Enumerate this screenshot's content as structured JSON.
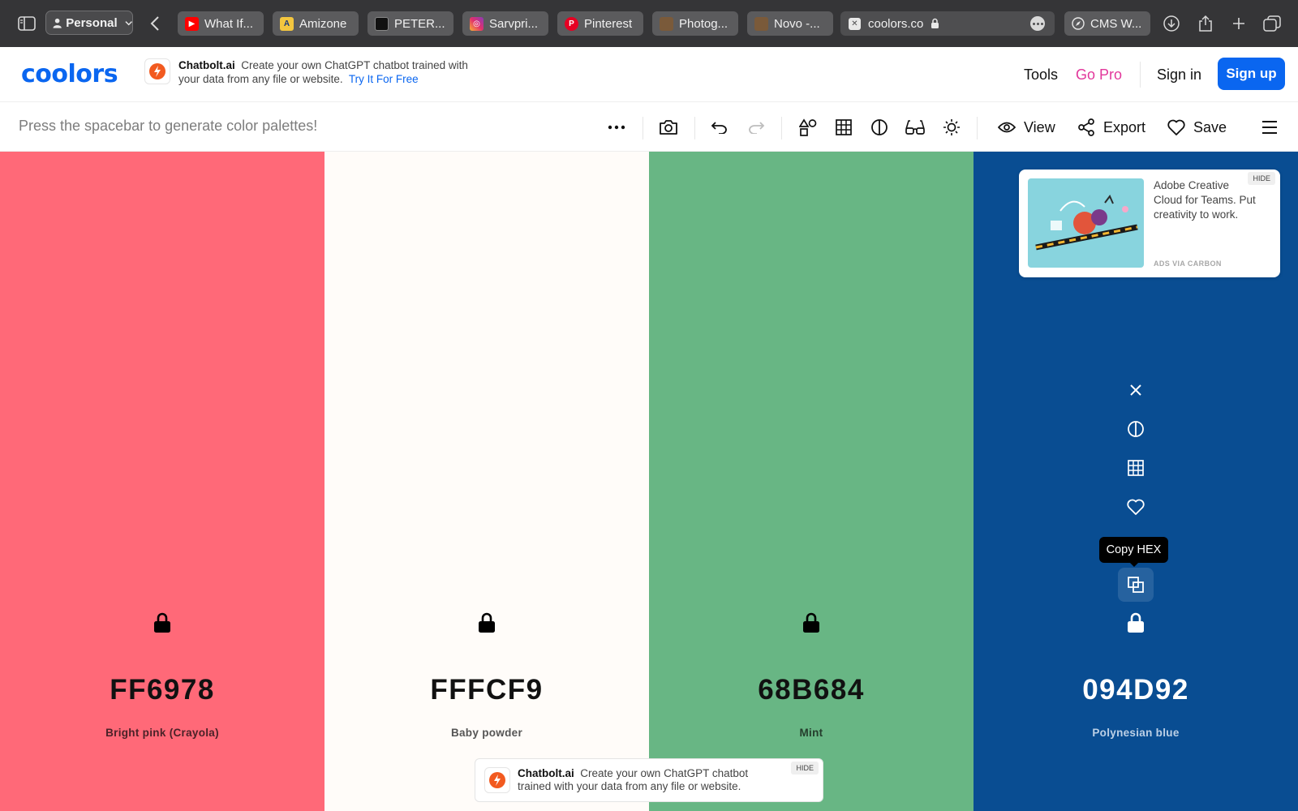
{
  "browser": {
    "profile": "Personal",
    "tabs": [
      {
        "title": "What If...",
        "favicon": "youtube-icon"
      },
      {
        "title": "Amizone",
        "favicon": "amizone-icon"
      },
      {
        "title": "PETER...",
        "favicon": "peter-icon"
      },
      {
        "title": "Sarvpri...",
        "favicon": "instagram-icon"
      },
      {
        "title": "Pinterest",
        "favicon": "pinterest-icon"
      },
      {
        "title": "Photog...",
        "favicon": "photo-icon"
      },
      {
        "title": "Novo -...",
        "favicon": "photo-icon"
      }
    ],
    "address": "coolors.co",
    "pinned_tab": "CMS W..."
  },
  "header": {
    "logo": "coolors",
    "promo": {
      "brand": "Chatbolt.ai",
      "text": "Create your own ChatGPT chatbot trained with your data from any file or website.",
      "cta": "Try It For Free"
    },
    "nav": {
      "tools": "Tools",
      "gopro": "Go Pro",
      "signin": "Sign in",
      "signup": "Sign up"
    },
    "colors": {
      "brand": "#0a66f0",
      "gopro": "#e2379b"
    }
  },
  "toolbar": {
    "hint": "Press the spacebar to generate color palettes!",
    "view": "View",
    "export": "Export",
    "save": "Save"
  },
  "palette": [
    {
      "hex": "FF6978",
      "name": "Bright pink (Crayola)",
      "color": "#FF6978",
      "text_color": "#111111",
      "name_color": "#4a2228"
    },
    {
      "hex": "FFFCF9",
      "name": "Baby powder",
      "color": "#FFFCF9",
      "text_color": "#111111",
      "name_color": "#555555"
    },
    {
      "hex": "68B684",
      "name": "Mint",
      "color": "#68B684",
      "text_color": "#111111",
      "name_color": "#253d2c"
    },
    {
      "hex": "094D92",
      "name": "Polynesian blue",
      "color": "#094D92",
      "text_color": "#ffffff",
      "name_color": "#bcd0e6"
    }
  ],
  "swatch_tools": {
    "tooltip": "Copy HEX"
  },
  "ad": {
    "text": "Adobe Creative Cloud for Teams. Put creativity to work.",
    "via": "ADS VIA CARBON",
    "hide": "HIDE"
  },
  "bottom_ad": {
    "brand": "Chatbolt.ai",
    "text": "Create your own ChatGPT chatbot trained with your data from any file or website.",
    "hide": "HIDE"
  }
}
